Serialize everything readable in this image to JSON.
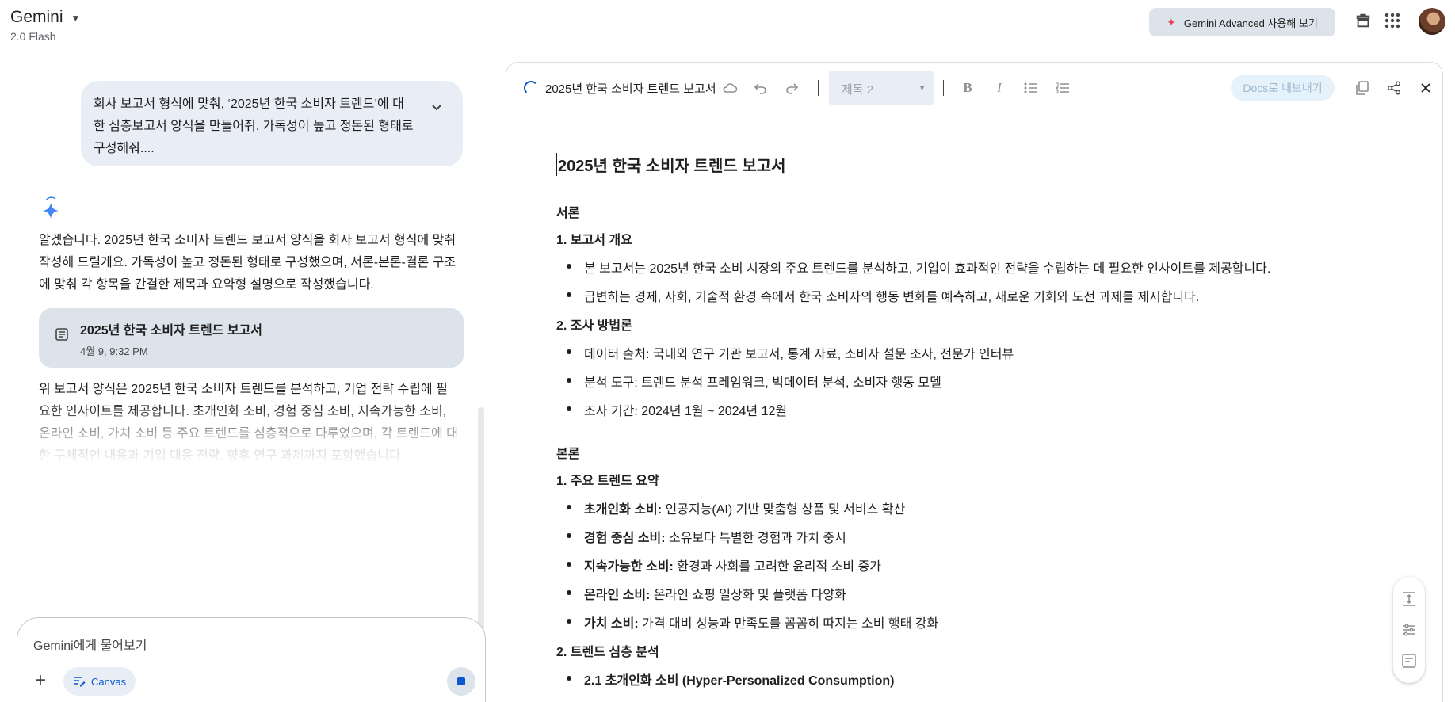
{
  "header": {
    "app_title": "Gemini",
    "model": "2.0 Flash",
    "advanced_cta": "Gemini Advanced 사용해 보기",
    "icons": [
      "spark-icon",
      "gift-icon",
      "apps-grid-icon",
      "avatar"
    ]
  },
  "chat": {
    "user_prompt": "회사 보고서 형식에 맞춰, ‘2025년 한국 소비자 트렌드’에 대한 심층보고서 양식을 만들어줘. 가독성이 높고 정돈된 형태로 구성해줘....",
    "reply_intro": "알겠습니다. 2025년 한국 소비자 트렌드 보고서 양식을 회사 보고서 형식에 맞춰 작성해 드릴게요. 가독성이 높고 정돈된 형태로 구성했으며, 서론-본론-결론 구조에 맞춰 각 항목을 간결한 제목과 요약형 설명으로 작성했습니다.",
    "doc_card": {
      "title": "2025년 한국 소비자 트렌드 보고서",
      "time": "4월 9, 9:32 PM"
    },
    "reply_followup": "위 보고서 양식은 2025년 한국 소비자 트렌드를 분석하고, 기업 전략 수립에 필요한 인사이트를 제공합니다. 초개인화 소비, 경험 중심 소비, 지속가능한 소비, 온라인 소비, 가치 소비 등 주요 트렌드를 심층적으로 다루었으며, 각 트렌드에 대한 구체적인 내용과 기업 대응 전략, 향후 연구 과제까지 포함했습니다."
  },
  "input": {
    "placeholder": "Gemini에게 물어보기",
    "canvas_label": "Canvas"
  },
  "canvas": {
    "toolbar_title": "2025년 한국 소비자 트렌드 보고서",
    "heading_style": "제목 2",
    "export_label": "Docs로 내보내기"
  },
  "document": {
    "title": "2025년 한국 소비자 트렌드 보고서",
    "intro_heading": "서론",
    "s1_heading": "1. 보고서 개요",
    "s1_b1": "본 보고서는 2025년 한국 소비 시장의 주요 트렌드를 분석하고, 기업이 효과적인 전략을 수립하는 데 필요한 인사이트를 제공합니다.",
    "s1_b2": "급변하는 경제, 사회, 기술적 환경 속에서 한국 소비자의 행동 변화를 예측하고, 새로운 기회와 도전 과제를 제시합니다.",
    "s2_heading": "2. 조사 방법론",
    "s2_b1": "데이터 출처: 국내외 연구 기관 보고서, 통계 자료, 소비자 설문 조사, 전문가 인터뷰",
    "s2_b2": "분석 도구: 트렌드 분석 프레임워크, 빅데이터 분석, 소비자 행동 모델",
    "s2_b3": "조사 기간: 2024년 1월 ~ 2024년 12월",
    "body_heading": "본론",
    "t1_heading": "1. 주요 트렌드 요약",
    "trends": [
      {
        "label": "초개인화 소비:",
        "text": " 인공지능(AI) 기반 맞춤형 상품 및 서비스 확산"
      },
      {
        "label": "경험 중심 소비:",
        "text": " 소유보다 특별한 경험과 가치 중시"
      },
      {
        "label": "지속가능한 소비:",
        "text": " 환경과 사회를 고려한 윤리적 소비 증가"
      },
      {
        "label": "온라인 소비:",
        "text": " 온라인 쇼핑 일상화 및 플랫폼 다양화"
      },
      {
        "label": "가치 소비:",
        "text": " 가격 대비 성능과 만족도를 꼼꼼히 따지는 소비 행태 강화"
      }
    ],
    "t2_heading": "2. 트렌드 심층 분석",
    "t2_b1": "2.1 초개인화 소비 (Hyper-Personalized Consumption)"
  },
  "colors": {
    "accent_blue": "#0b57d0",
    "chip_bg": "#e9eef6",
    "card_bg": "#dde3ea",
    "spark_red": "#e3455b"
  }
}
